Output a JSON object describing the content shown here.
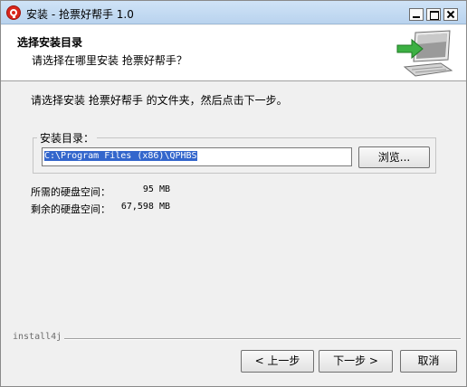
{
  "window": {
    "title": "安装 - 抢票好帮手 1.0"
  },
  "header": {
    "title": "选择安装目录",
    "subtitle": "请选择在哪里安装 抢票好帮手？"
  },
  "main": {
    "instruction": "请选择安装 抢票好帮手 的文件夹，然后点击下一步。",
    "directory_group_label": "安装目录：",
    "directory_path": "C:\\Program Files (x86)\\QPHBS",
    "browse_label": "浏览...",
    "required_space_label": "所需的硬盘空间：",
    "required_space_value": "95 MB",
    "free_space_label": "剩余的硬盘空间：",
    "free_space_value": "67,598 MB"
  },
  "footer": {
    "brand": "install4j",
    "back_label": "< 上一步",
    "next_label": "下一步 >",
    "cancel_label": "取消"
  },
  "colors": {
    "selection": "#3366cc",
    "arrow_green": "#3cb043",
    "app_icon_red": "#d9261c"
  },
  "icons": {
    "app": "app-logo-icon",
    "header_graphic": "install-computer-icon"
  }
}
